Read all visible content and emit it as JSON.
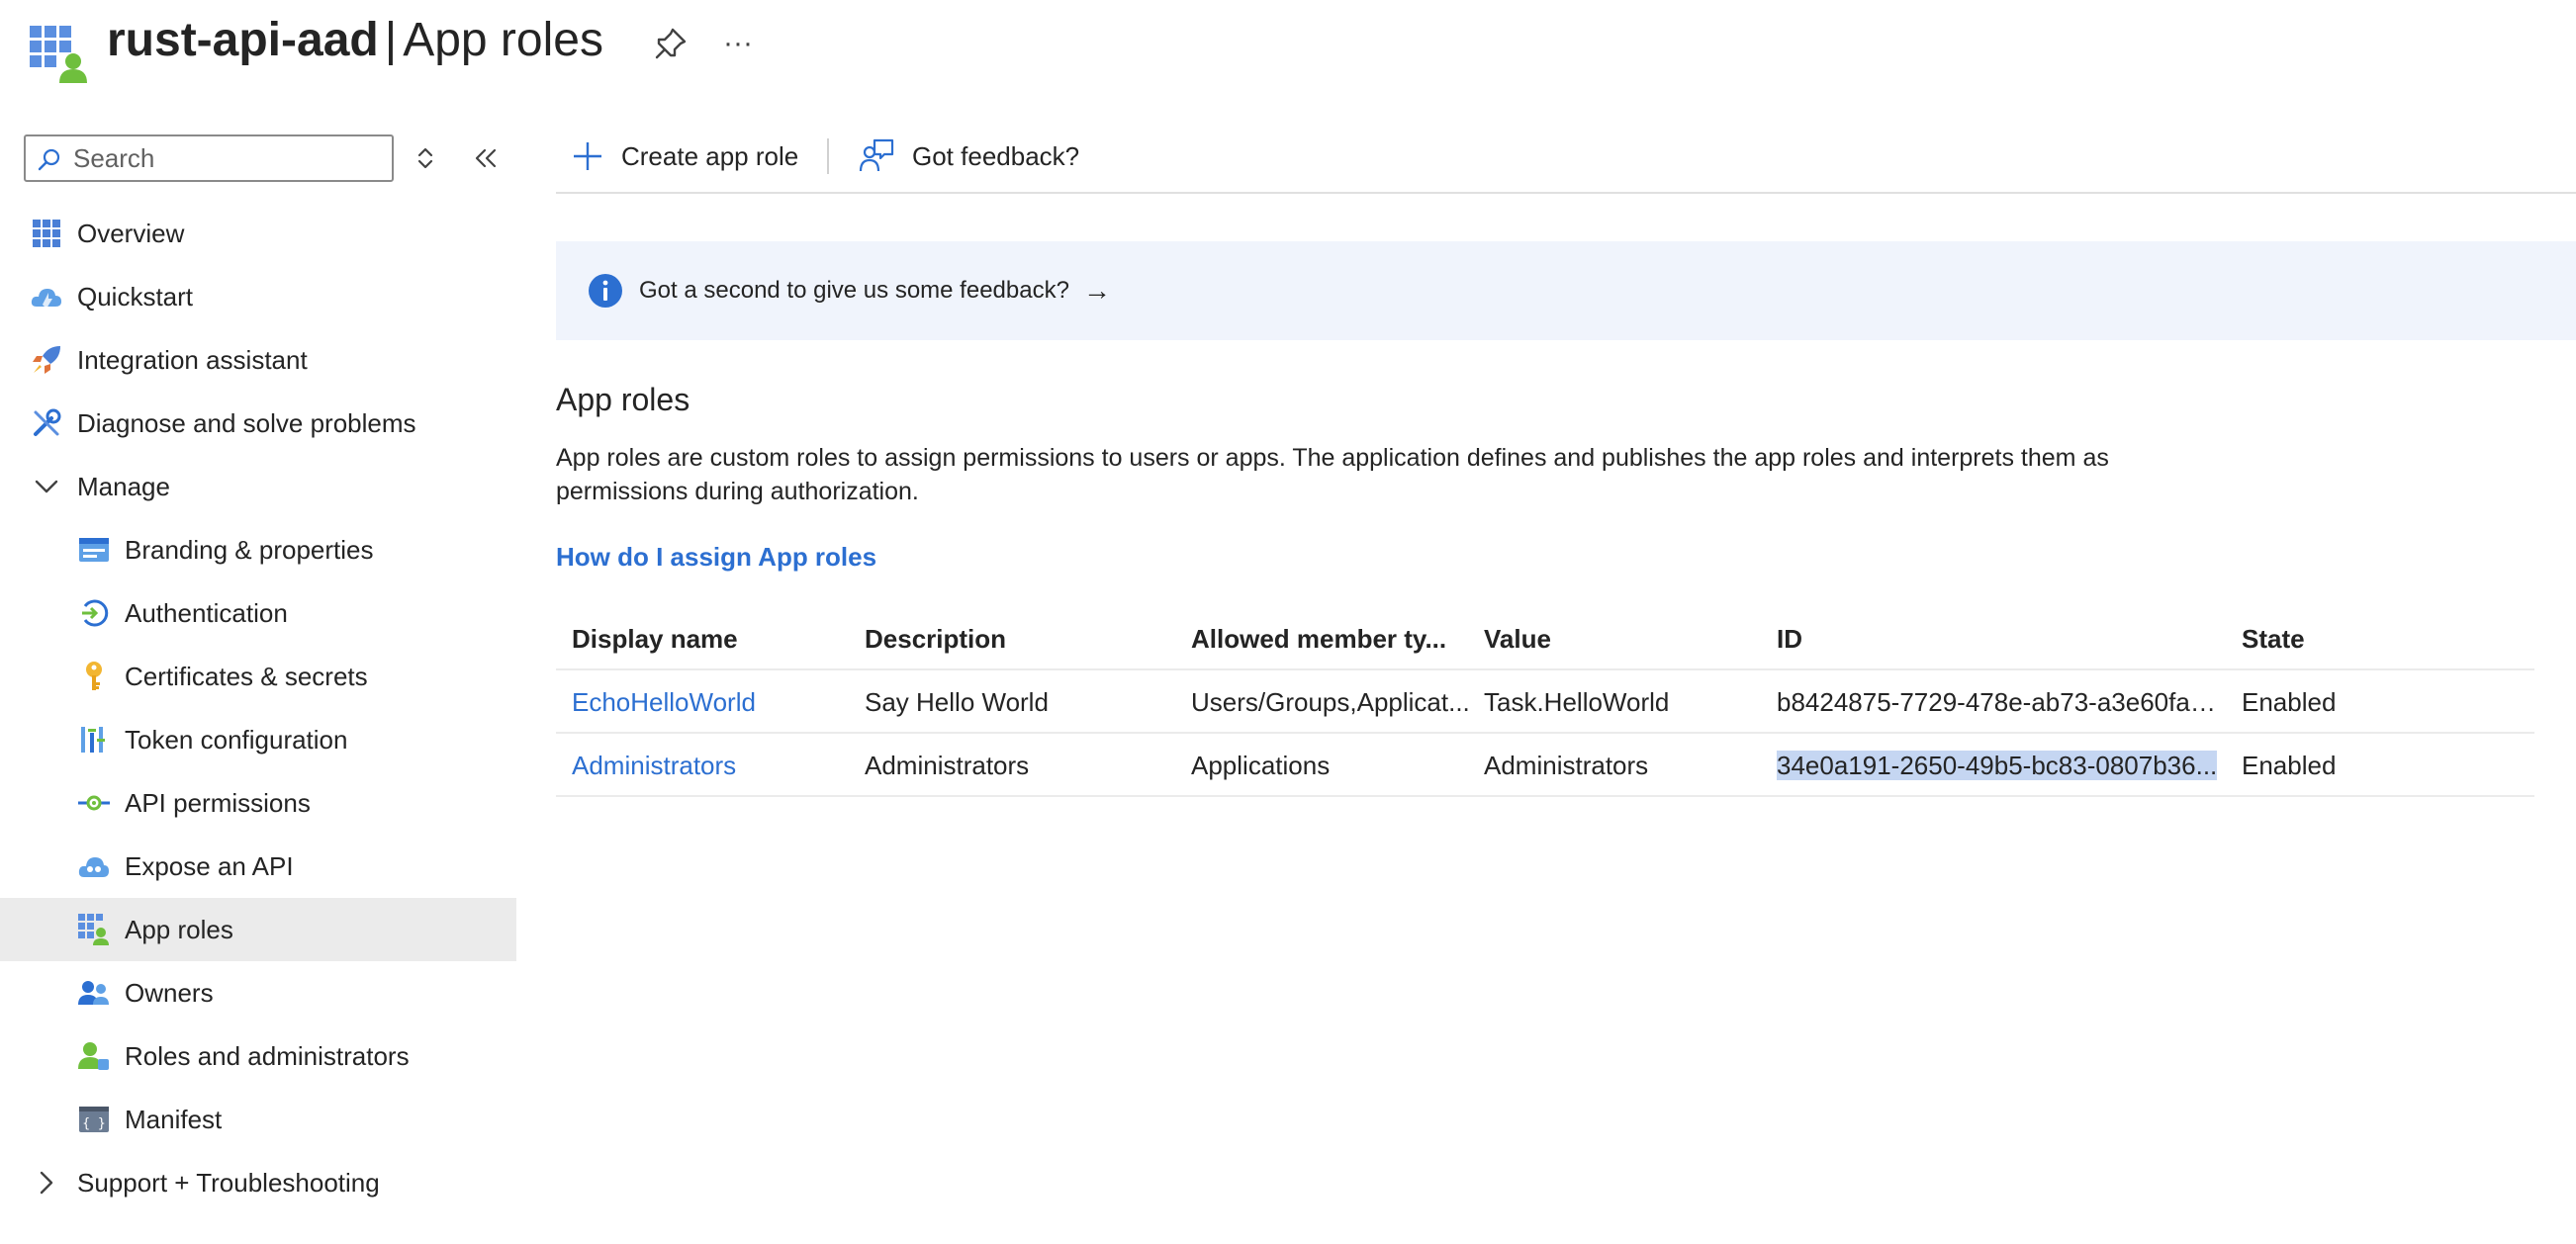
{
  "header": {
    "resource_name": "rust-api-aad",
    "separator": "|",
    "blade_title": "App roles",
    "app_icon": "app-registration-icon",
    "pin_icon": "pin-icon",
    "more_icon": "more-options-icon",
    "more_glyph": "···"
  },
  "sidebar": {
    "search": {
      "placeholder": "Search",
      "value": ""
    },
    "items": [
      {
        "label": "Overview",
        "icon": "overview-grid-icon",
        "level": 0
      },
      {
        "label": "Quickstart",
        "icon": "quickstart-cloud-icon",
        "level": 0
      },
      {
        "label": "Integration assistant",
        "icon": "rocket-icon",
        "level": 0
      },
      {
        "label": "Diagnose and solve problems",
        "icon": "wrench-icon",
        "level": 0
      },
      {
        "label": "Manage",
        "icon": "chevron-down-icon",
        "level": 0,
        "expanded": true
      },
      {
        "label": "Branding & properties",
        "icon": "branding-icon",
        "level": 1
      },
      {
        "label": "Authentication",
        "icon": "authentication-icon",
        "level": 1
      },
      {
        "label": "Certificates & secrets",
        "icon": "key-icon",
        "level": 1
      },
      {
        "label": "Token configuration",
        "icon": "token-bars-icon",
        "level": 1
      },
      {
        "label": "API permissions",
        "icon": "api-permissions-icon",
        "level": 1
      },
      {
        "label": "Expose an API",
        "icon": "expose-api-cloud-icon",
        "level": 1
      },
      {
        "label": "App roles",
        "icon": "app-roles-icon",
        "level": 1,
        "active": true
      },
      {
        "label": "Owners",
        "icon": "owners-icon",
        "level": 1
      },
      {
        "label": "Roles and administrators",
        "icon": "roles-admins-icon",
        "level": 1
      },
      {
        "label": "Manifest",
        "icon": "manifest-icon",
        "level": 1
      },
      {
        "label": "Support + Troubleshooting",
        "icon": "chevron-right-icon",
        "level": 0,
        "expanded": false
      }
    ]
  },
  "toolbar": {
    "create_label": "Create app role",
    "feedback_label": "Got feedback?"
  },
  "banner": {
    "text": "Got a second to give us some feedback?",
    "arrow": "→"
  },
  "content": {
    "section_title": "App roles",
    "description": "App roles are custom roles to assign permissions to users or apps. The application defines and publishes the app roles and interprets them as permissions during authorization.",
    "help_link": "How do I assign App roles"
  },
  "table": {
    "columns": [
      "Display name",
      "Description",
      "Allowed member ty...",
      "Value",
      "ID",
      "State"
    ],
    "rows": [
      [
        "EchoHelloWorld",
        "Say Hello World",
        "Users/Groups,Applicat...",
        "Task.HelloWorld",
        "b8424875-7729-478e-ab73-a3e60fad...",
        "Enabled"
      ],
      [
        "Administrators",
        "Administrators",
        "Applications",
        "Administrators",
        "34e0a191-2650-49b5-bc83-0807b36...",
        "Enabled"
      ]
    ]
  },
  "colors": {
    "accent": "#2c6fd1",
    "active_nav_bg": "#ebebeb",
    "banner_bg": "#f0f4fc",
    "selection": "#c5d6f2"
  }
}
